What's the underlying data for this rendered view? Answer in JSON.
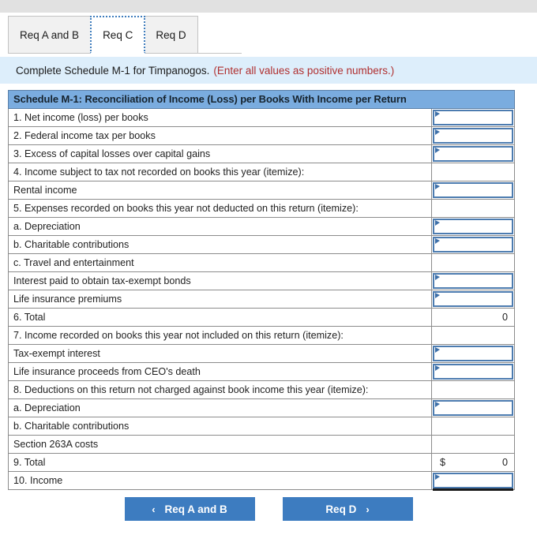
{
  "tabs": [
    {
      "label": "Req A and B",
      "active": false
    },
    {
      "label": "Req C",
      "active": true
    },
    {
      "label": "Req D",
      "active": false
    }
  ],
  "instruction": {
    "text": "Complete Schedule M-1 for Timpanogos.",
    "note": "(Enter all values as positive numbers.)"
  },
  "schedule": {
    "banner": "Schedule M-1: Reconciliation of Income (Loss) per Books With Income per Return",
    "rows": [
      {
        "label": "1. Net income (loss) per books",
        "type": "input",
        "value": ""
      },
      {
        "label": "2. Federal income tax per books",
        "type": "input",
        "value": ""
      },
      {
        "label": "3. Excess of capital losses over capital gains",
        "type": "input",
        "value": ""
      },
      {
        "label": "4. Income subject to tax not recorded on books this year (itemize):",
        "type": "empty",
        "value": ""
      },
      {
        "label": "Rental income",
        "type": "input",
        "value": ""
      },
      {
        "label": "5. Expenses recorded on books this year not deducted on this return (itemize):",
        "type": "empty",
        "value": ""
      },
      {
        "label": "a. Depreciation",
        "type": "input",
        "value": ""
      },
      {
        "label": "b. Charitable contributions",
        "type": "input",
        "value": ""
      },
      {
        "label": "c. Travel and entertainment",
        "type": "empty",
        "value": ""
      },
      {
        "label": "Interest paid to obtain tax-exempt bonds",
        "type": "input",
        "value": ""
      },
      {
        "label": "Life insurance premiums",
        "type": "input",
        "value": ""
      },
      {
        "label": "6. Total",
        "type": "total",
        "value": "0"
      },
      {
        "label": "7. Income recorded on books this year not included on this return (itemize):",
        "type": "empty",
        "value": ""
      },
      {
        "label": "Tax-exempt interest",
        "type": "input",
        "value": ""
      },
      {
        "label": "Life insurance proceeds from CEO's death",
        "type": "input",
        "value": ""
      },
      {
        "label": "8. Deductions on this return not charged against book income this year (itemize):",
        "type": "empty",
        "value": ""
      },
      {
        "label": "a. Depreciation",
        "type": "input",
        "value": ""
      },
      {
        "label": "b. Charitable contributions",
        "type": "empty",
        "value": ""
      },
      {
        "label": "Section 263A costs",
        "type": "empty",
        "value": ""
      },
      {
        "label": "9. Total",
        "type": "total-dollar",
        "currency": "$",
        "value": "0"
      },
      {
        "label": "10. Income",
        "type": "input-shadow",
        "value": ""
      }
    ]
  },
  "nav": {
    "prev": {
      "label": "Req A and B",
      "icon": "chevron-left-icon",
      "glyph": "‹"
    },
    "next": {
      "label": "Req D",
      "icon": "chevron-right-icon",
      "glyph": "›"
    }
  },
  "colors": {
    "banner_blue": "#7aacdf",
    "instruction_blue": "#ddeefb",
    "note_red": "#b03030",
    "button_blue": "#3d7cc0",
    "input_border": "#4d7cb0"
  }
}
